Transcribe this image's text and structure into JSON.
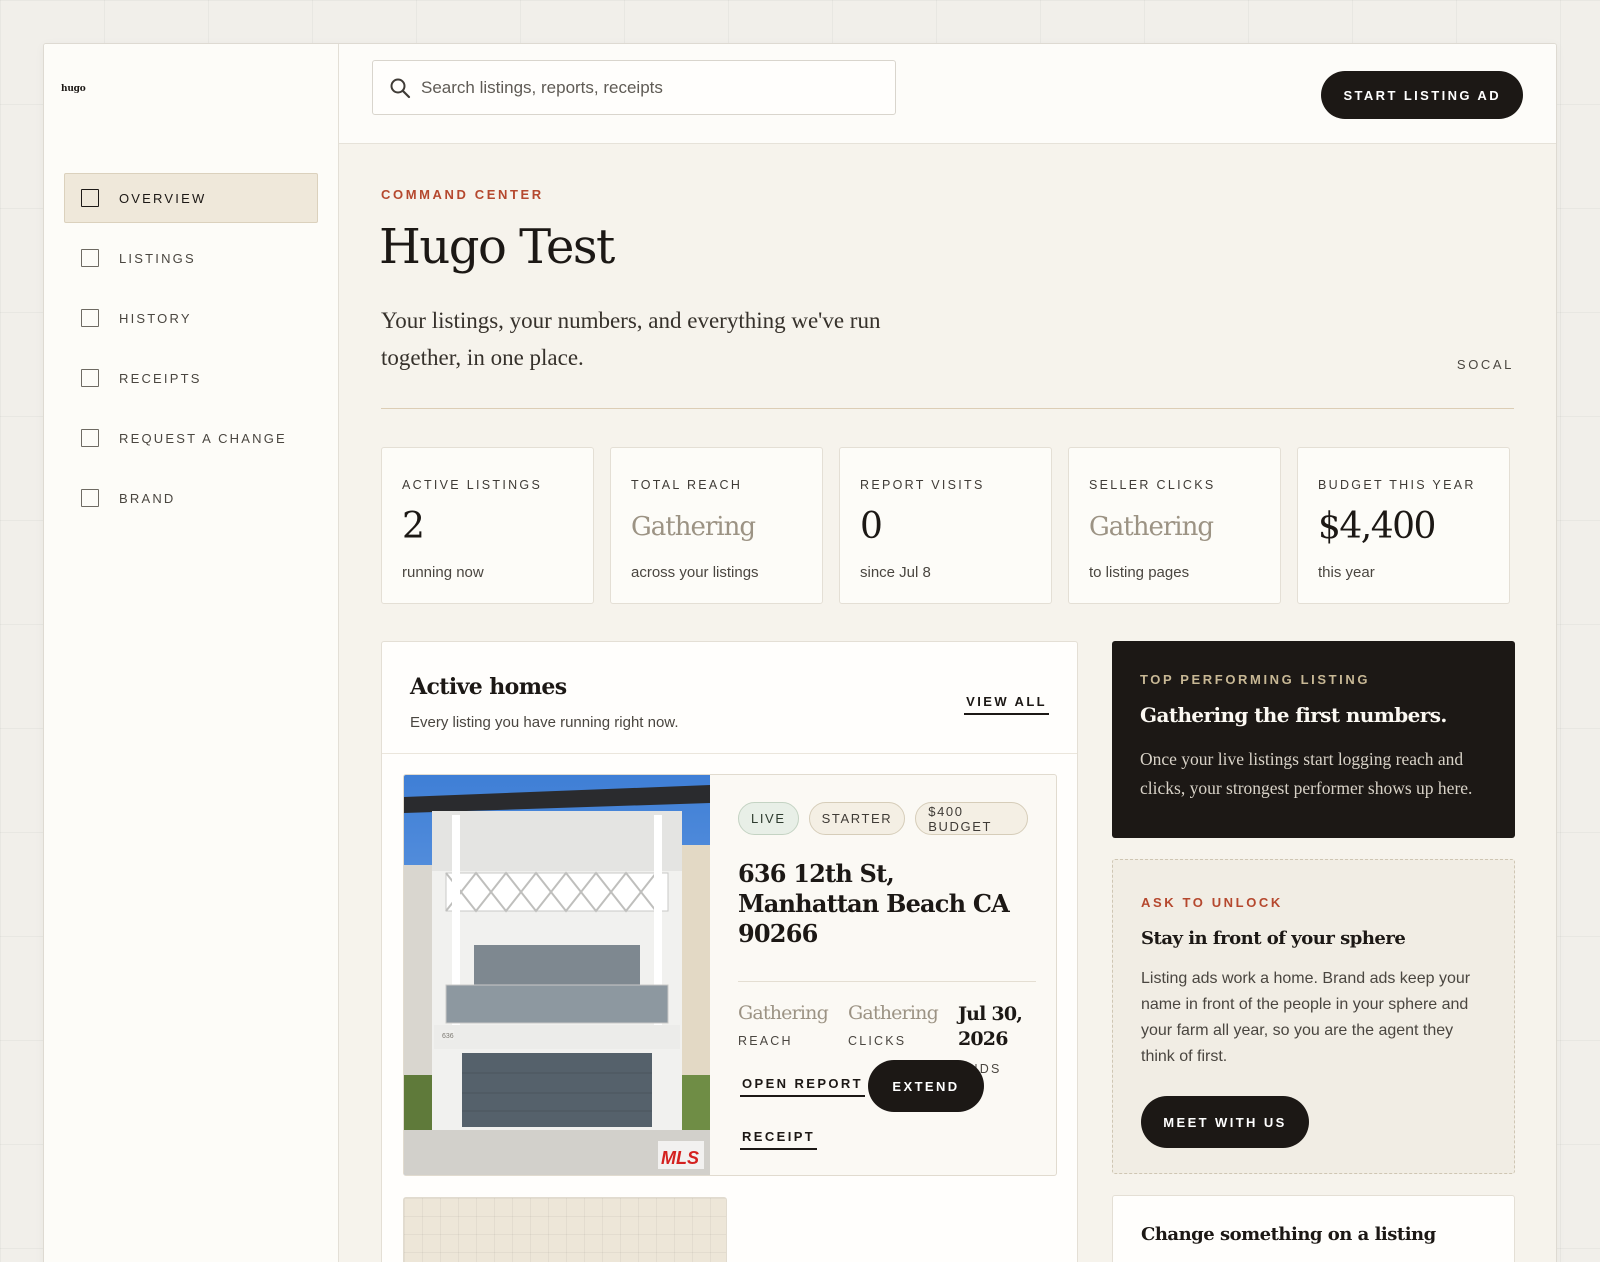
{
  "brand": {
    "logo_text": "hugo"
  },
  "search": {
    "placeholder": "Search listings, reports, receipts"
  },
  "header": {
    "cta_label": "START LISTING AD"
  },
  "sidebar": {
    "items": [
      {
        "label": "OVERVIEW",
        "active": true
      },
      {
        "label": "LISTINGS",
        "active": false
      },
      {
        "label": "HISTORY",
        "active": false
      },
      {
        "label": "RECEIPTS",
        "active": false
      },
      {
        "label": "REQUEST A CHANGE",
        "active": false
      },
      {
        "label": "BRAND",
        "active": false
      }
    ]
  },
  "page": {
    "eyebrow": "COMMAND CENTER",
    "title": "Hugo Test",
    "subtitle": "Your listings, your numbers, and everything we've run together, in one place.",
    "region": "SOCAL"
  },
  "stats": [
    {
      "label": "ACTIVE LISTINGS",
      "value": "2",
      "note": "running now"
    },
    {
      "label": "TOTAL REACH",
      "value": "Gathering",
      "note": "across your listings"
    },
    {
      "label": "REPORT VISITS",
      "value": "0",
      "note": "since Jul 8"
    },
    {
      "label": "SELLER CLICKS",
      "value": "Gathering",
      "note": "to listing pages"
    },
    {
      "label": "BUDGET THIS YEAR",
      "value": "$4,400",
      "note": "this year"
    }
  ],
  "active_homes": {
    "title": "Active homes",
    "subtitle": "Every listing you have running right now.",
    "view_all_label": "VIEW ALL",
    "listing": {
      "chips": [
        "LIVE",
        "STARTER",
        "$400 BUDGET"
      ],
      "address": "636 12th St, Manhattan Beach CA 90266",
      "reach_value": "Gathering",
      "reach_label": "REACH",
      "clicks_value": "Gathering",
      "clicks_label": "CLICKS",
      "ends_value": "Jul 30, 2026",
      "ends_label": "ENDS",
      "open_report_label": "OPEN REPORT",
      "extend_label": "EXTEND",
      "receipt_label": "RECEIPT",
      "photo_house_number": "636",
      "photo_watermark": "MLS"
    }
  },
  "top_listing": {
    "eyebrow": "TOP PERFORMING LISTING",
    "title": "Gathering the first numbers.",
    "text": "Once your live listings start logging reach and clicks, your strongest performer shows up here."
  },
  "unlock": {
    "eyebrow": "ASK TO UNLOCK",
    "title": "Stay in front of your sphere",
    "text": "Listing ads work a home. Brand ads keep your name in front of the people in your sphere and your farm all year, so you are the agent they think of first.",
    "button_label": "MEET WITH US"
  },
  "change_card": {
    "title": "Change something on a listing"
  },
  "colors": {
    "accent": "#b5482e",
    "ink": "#1c1815",
    "panel": "#f6f3ec",
    "muted_value": "#9c9384",
    "live_chip": "#e8efe7"
  }
}
